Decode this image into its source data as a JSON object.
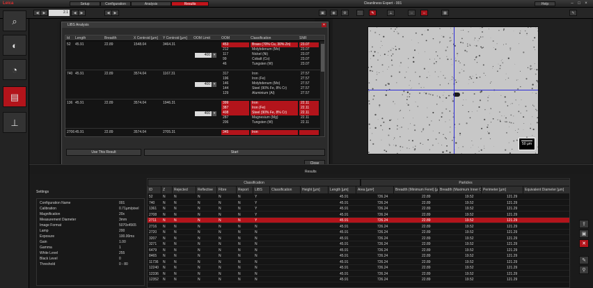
{
  "window": {
    "brand": "Leica",
    "title": "Cleanliness Expert - 001",
    "help": "Help",
    "tabs": [
      "Setup",
      "Configuration",
      "Analysis",
      "Results"
    ],
    "active_tab": 3,
    "controls": [
      "–",
      "□",
      "×"
    ]
  },
  "toolbar": {
    "zoom": "2.1",
    "left_buttons": [
      "◀",
      "▶",
      "◀",
      "▶",
      "◀",
      "▶"
    ],
    "right_buttons": [
      "▣",
      "◉",
      "⚙",
      "⬛",
      "✎",
      "⟂",
      "⇔",
      "⇔",
      "▦",
      "✎"
    ]
  },
  "leftbar": [
    "setup-icon",
    "camera-icon",
    "analysis-icon",
    "results-icon",
    "microscope-icon"
  ],
  "dialog": {
    "title": "LIBS Analysis",
    "close": "×",
    "headers": [
      "Id",
      "Length",
      "Breadth",
      "X Centroid [µm]",
      "Y Centroid [µm]",
      "OOM Limit",
      "OOM",
      "Classification",
      "SNR"
    ],
    "groups": [
      {
        "id": "52",
        "length": "45.91",
        "breadth": "22.89",
        "x": "1548.04",
        "y": "3464.31",
        "oom_limit": "400",
        "rows": [
          {
            "oom": "453",
            "cls": "Brass (70% Cu, 30% Zn)",
            "snr": "23.07",
            "red": true
          },
          {
            "oom": "212",
            "cls": "Molybdenum (Mo)",
            "snr": "23.07",
            "red": false
          },
          {
            "oom": "117",
            "cls": "Nickel (Ni)",
            "snr": "23.07",
            "red": false
          },
          {
            "oom": "99",
            "cls": "Cobalt (Co)",
            "snr": "23.07",
            "red": false
          },
          {
            "oom": "46",
            "cls": "Tungsten (W)",
            "snr": "23.07",
            "red": false
          }
        ]
      },
      {
        "id": "740",
        "length": "45.91",
        "breadth": "22.89",
        "x": "3574.04",
        "y": "1167.31",
        "oom_limit": "400",
        "rows": [
          {
            "oom": "317",
            "cls": "Iron",
            "snr": "27.57",
            "red": false
          },
          {
            "oom": "196",
            "cls": "Iron (Fe)",
            "snr": "27.57",
            "red": false
          },
          {
            "oom": "146",
            "cls": "Molybdenum (Mo)",
            "snr": "27.57",
            "red": false
          },
          {
            "oom": "144",
            "cls": "Steel (90% Fe, 8% Cr)",
            "snr": "27.57",
            "red": false
          },
          {
            "oom": "129",
            "cls": "Aluminium (Al)",
            "snr": "27.57",
            "red": false
          }
        ]
      },
      {
        "id": "136",
        "length": "45.91",
        "breadth": "22.89",
        "x": "3574.04",
        "y": "1946.31",
        "oom_limit": "400",
        "rows": [
          {
            "oom": "399",
            "cls": "Iron",
            "snr": "22.11",
            "red": true
          },
          {
            "oom": "387",
            "cls": "Iron (Fe)",
            "snr": "22.11",
            "red": true
          },
          {
            "oom": "408",
            "cls": "Steel (90% Fe, 8% Cr)",
            "snr": "22.11",
            "red": true
          },
          {
            "oom": "287",
            "cls": "Magnesium (Mg)",
            "snr": "22.11",
            "red": false
          },
          {
            "oom": "206",
            "cls": "Tungsten (W)",
            "snr": "22.11",
            "red": false
          }
        ]
      },
      {
        "id": "2706",
        "length": "45.91",
        "breadth": "22.89",
        "x": "3574.04",
        "y": "2705.31",
        "oom_limit": "",
        "rows": [
          {
            "oom": "345",
            "cls": "Iron",
            "snr": "",
            "red": true
          }
        ]
      }
    ],
    "use_result": "Use This Result",
    "start": "Start",
    "close_btn": "Close"
  },
  "scalebar": "50 µm",
  "results_label": "Results",
  "settings": {
    "title": "Settings",
    "rows": [
      [
        "Configuration Name",
        "001"
      ],
      [
        "Calibration",
        "0.71µm/pixel"
      ],
      [
        "Magnification",
        "20x"
      ],
      [
        "Measurement Diameter",
        "3mm"
      ],
      [
        "Image Format",
        "5070x4565"
      ],
      [
        "Lamp",
        "200"
      ],
      [
        "Exposure",
        "100.00ms"
      ],
      [
        "Gain",
        "1.00"
      ],
      [
        "Gamma",
        "1"
      ],
      [
        "White Level",
        "255"
      ],
      [
        "Black Level",
        "0"
      ],
      [
        "Threshold",
        "0 - 80"
      ]
    ]
  },
  "results": {
    "groups": [
      "Classification",
      "Particles"
    ],
    "headers": [
      "ID",
      "Z",
      "Rejected",
      "Reflective",
      "Fibre",
      "Report",
      "LIBS",
      "Classification",
      "Height [µm]",
      "Length [µm]",
      "Area [µm²]",
      "Breadth (Minimum Feret) [µm]",
      "Breadth (Maximum Inner Circle) [µm]",
      "Perimeter [µm]",
      "Equivalent Diameter [µm]"
    ],
    "rows": [
      [
        "52",
        "N",
        "N",
        "N",
        "N",
        "N",
        "Y",
        "",
        "",
        "45.91",
        "726.24",
        "22.89",
        "19.52",
        "121.29",
        ""
      ],
      [
        "740",
        "N",
        "N",
        "N",
        "N",
        "N",
        "Y",
        "",
        "",
        "45.91",
        "726.24",
        "22.89",
        "19.52",
        "121.29",
        ""
      ],
      [
        "1361",
        "N",
        "N",
        "N",
        "N",
        "N",
        "Y",
        "",
        "",
        "45.91",
        "726.24",
        "22.89",
        "19.52",
        "121.29",
        ""
      ],
      [
        "2708",
        "N",
        "N",
        "N",
        "N",
        "N",
        "Y",
        "",
        "",
        "45.91",
        "726.24",
        "22.89",
        "19.52",
        "121.29",
        ""
      ],
      [
        "2711",
        "N",
        "N",
        "N",
        "N",
        "N",
        "Y",
        "",
        "",
        "45.91",
        "726.24",
        "22.89",
        "19.52",
        "121.29",
        ""
      ],
      [
        "2716",
        "N",
        "N",
        "N",
        "N",
        "N",
        "N",
        "",
        "",
        "45.91",
        "726.24",
        "22.89",
        "19.52",
        "121.29",
        ""
      ],
      [
        "2720",
        "N",
        "N",
        "N",
        "N",
        "N",
        "N",
        "",
        "",
        "45.91",
        "726.24",
        "22.89",
        "19.52",
        "121.29",
        ""
      ],
      [
        "3207",
        "N",
        "N",
        "N",
        "N",
        "N",
        "N",
        "",
        "",
        "45.91",
        "726.24",
        "22.89",
        "19.52",
        "121.29",
        ""
      ],
      [
        "3271",
        "N",
        "N",
        "N",
        "N",
        "N",
        "N",
        "",
        "",
        "45.91",
        "726.24",
        "22.89",
        "19.52",
        "121.29",
        ""
      ],
      [
        "6479",
        "N",
        "N",
        "N",
        "N",
        "N",
        "N",
        "",
        "",
        "45.91",
        "726.24",
        "22.89",
        "19.52",
        "121.29",
        ""
      ],
      [
        "8465",
        "N",
        "N",
        "N",
        "N",
        "N",
        "N",
        "",
        "",
        "45.91",
        "726.24",
        "22.89",
        "19.52",
        "121.29",
        ""
      ],
      [
        "11736",
        "N",
        "N",
        "N",
        "N",
        "N",
        "N",
        "",
        "",
        "45.91",
        "726.24",
        "22.89",
        "19.52",
        "121.29",
        ""
      ],
      [
        "12240",
        "N",
        "N",
        "N",
        "N",
        "N",
        "N",
        "",
        "",
        "45.91",
        "726.24",
        "22.89",
        "19.52",
        "121.29",
        ""
      ],
      [
        "12336",
        "N",
        "N",
        "N",
        "N",
        "N",
        "N",
        "",
        "",
        "45.91",
        "726.24",
        "22.89",
        "19.52",
        "121.29",
        ""
      ],
      [
        "12352",
        "N",
        "N",
        "N",
        "N",
        "N",
        "N",
        "",
        "",
        "45.91",
        "726.24",
        "22.89",
        "19.52",
        "121.29",
        ""
      ]
    ],
    "selected_row": 4
  },
  "rightbar": [
    "export-icon",
    "print-icon",
    "delete-icon",
    "settings-icon",
    "tools-icon"
  ]
}
